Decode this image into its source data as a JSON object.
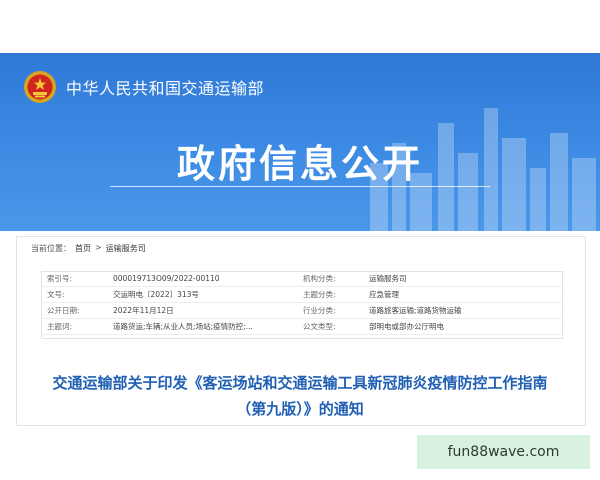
{
  "banner": {
    "org_name": "中华人民共和国交通运输部",
    "title": "政府信息公开",
    "emblem_icon": "national-emblem-icon",
    "bg_color": "#3a86e0"
  },
  "breadcrumb": {
    "prefix": "当前位置：",
    "items": [
      "首页",
      ">",
      "运输服务司"
    ]
  },
  "meta": {
    "rows": [
      {
        "k1": "索引号:",
        "v1": "000019713O09/2022-00110",
        "k2": "机构分类:",
        "v2": "运输服务司"
      },
      {
        "k1": "文号:",
        "v1": "交运明电〔2022〕313号",
        "k2": "主题分类:",
        "v2": "应急管理"
      },
      {
        "k1": "公开日期:",
        "v1": "2022年11月12日",
        "k2": "行业分类:",
        "v2": "道路旅客运输;道路货物运输"
      },
      {
        "k1": "主题词:",
        "v1": "道路货运;车辆;从业人员;场站;疫情防控;...",
        "k2": "公文类型:",
        "v2": "部明电或部办公厅明电"
      }
    ]
  },
  "article": {
    "title_line1": "交通运输部关于印发《客运场站和交通运输工具新冠肺炎疫情防控工作指南",
    "title_line2": "（第九版）》的通知"
  },
  "watermark": {
    "text": "fun88wave.com"
  }
}
